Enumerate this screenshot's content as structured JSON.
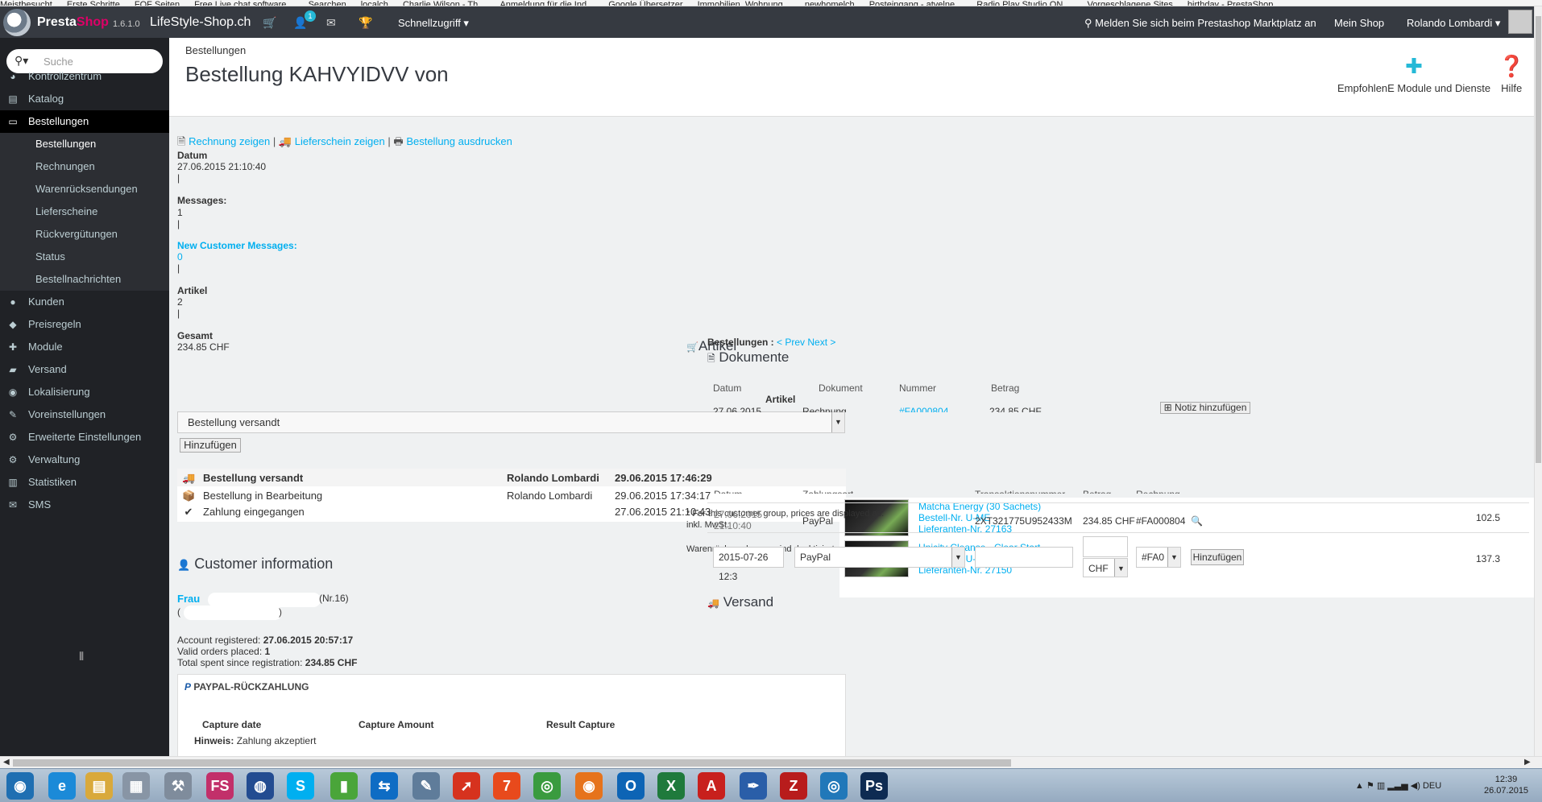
{
  "bookmarks": [
    "Meistbesucht",
    "Erste Schritte",
    "FOF Seiten",
    "Free Live chat software...",
    "Searchen",
    "localch",
    "Charlie Wilson - Th...",
    "Anmeldung für die Ind...",
    "Google Übersetzer",
    "Immobilien, Wohnung...",
    "newhomelch",
    "Posteingang - atvelne...",
    "Radio Play Studio ON ...",
    "Vorgeschlagene Sites",
    "birthday - PrestaShop ..."
  ],
  "topbar": {
    "brand_main": "Presta",
    "brand_accent": "Shop",
    "version": "1.6.1.0",
    "shop_name": "LifeStyle-Shop.ch",
    "notification_count": "1",
    "quick_access": "Schnellzugriff ▾",
    "marketplace": "Melden Sie sich beim Prestashop Marktplatz an",
    "my_shop": "Mein Shop",
    "user": "Rolando Lombardi ▾"
  },
  "sidebar": {
    "search_placeholder": "Suche",
    "items": [
      {
        "label": "Kontrollzentrum",
        "icon": "◕"
      },
      {
        "label": "Katalog",
        "icon": "▤"
      },
      {
        "label": "Bestellungen",
        "icon": "▭"
      },
      {
        "label": "Kunden",
        "icon": "●"
      },
      {
        "label": "Preisregeln",
        "icon": "◆"
      },
      {
        "label": "Module",
        "icon": "✚"
      },
      {
        "label": "Versand",
        "icon": "▰"
      },
      {
        "label": "Lokalisierung",
        "icon": "◉"
      },
      {
        "label": "Voreinstellungen",
        "icon": "✎"
      },
      {
        "label": "Erweiterte Einstellungen",
        "icon": "⚙"
      },
      {
        "label": "Verwaltung",
        "icon": "⚙"
      },
      {
        "label": "Statistiken",
        "icon": "▥"
      },
      {
        "label": "SMS",
        "icon": "✉"
      }
    ],
    "subitems": [
      "Bestellungen",
      "Rechnungen",
      "Warenrücksendungen",
      "Lieferscheine",
      "Rückvergütungen",
      "Status",
      "Bestellnachrichten"
    ]
  },
  "header": {
    "breadcrumb": "Bestellungen",
    "title": "Bestellung KAHVYIDVV von",
    "modules_label": "EmpfohlenE Module und Dienste",
    "help_label": "Hilfe"
  },
  "order": {
    "links": {
      "invoice": "Rechnung zeigen",
      "delivery": "Lieferschein zeigen",
      "print": "Bestellung ausdrucken",
      "sep": "|"
    },
    "date_label": "Datum",
    "date_value": "27.06.2015 21:10:40",
    "messages_label": "Messages:",
    "messages_value": "1",
    "new_msgs_label": "New Customer Messages:",
    "new_msgs_value": "0",
    "products_label": "Artikel",
    "products_value": "2",
    "total_label": "Gesamt",
    "total_value": "234.85 CHF",
    "pipe": "|",
    "status_selected": "Bestellung versandt",
    "add_button": "Hinzufügen"
  },
  "history": [
    {
      "status": "Bestellung versandt",
      "user": "Rolando Lombardi",
      "date": "29.06.2015 17:46:29",
      "icon": "🚚",
      "bold": true
    },
    {
      "status": "Bestellung in Bearbeitung",
      "user": "Rolando Lombardi",
      "date": "29.06.2015 17:34:17",
      "icon": "📦",
      "bold": false
    },
    {
      "status": "Zahlung eingegangen",
      "user": "",
      "date": "27.06.2015 21:10:43",
      "icon": "✔",
      "bold": false
    }
  ],
  "customer": {
    "heading": "Customer information",
    "name": "Frau",
    "number": "(Nr.16)",
    "open_paren": "(",
    "close_paren": ")",
    "registered_label": "Account registered:",
    "registered_value": "27.06.2015 20:57:17",
    "orders_label": "Valid orders placed:",
    "orders_value": "1",
    "spent_label": "Total spent since registration:",
    "spent_value": "234.85 CHF"
  },
  "paypal": {
    "heading": "PAYPAL-RÜCKZAHLUNG",
    "col1": "Capture date",
    "col2": "Capture Amount",
    "col3": "Result Capture",
    "note_label": "Hinweis:",
    "note_value": "Zahlung akzeptiert"
  },
  "right": {
    "artikel_heading": "Artikel",
    "orders_nav_label": "Bestellungen :",
    "prev": "< Prev",
    "next": "Next >",
    "documents_heading": "Dokumente",
    "doc_cols": [
      "Datum",
      "Dokument",
      "Nummer",
      "Betrag"
    ],
    "doc_row": {
      "date": "27.06.2015",
      "type": "Rechnung",
      "number": "#FA000804",
      "amount": "234.85 CHF",
      "note": "Notiz hinzufügen"
    },
    "artikel_sub": "Artikel",
    "products": [
      {
        "name": "Matcha Energy (30 Sachets)",
        "ref": "Bestell-Nr. U-ME",
        "supplier": "Lieferanten-Nr. 27163",
        "price": "102.5"
      },
      {
        "name": "Unicity Cleanse - Clear Start",
        "ref": "Bestell-Nr. U-CS",
        "supplier": "Lieferanten-Nr. 27150",
        "price": "137.3"
      }
    ],
    "pay_cols": [
      "Datum",
      "Zahlungsart",
      "Transaktionsnummer",
      "Betrag",
      "Rechnung"
    ],
    "price_note": "* For this customer group, prices are displayed as:",
    "price_note2": "inkl. MwSt.",
    "pay_row": {
      "date": "27.06.2015",
      "time": "21:10:40",
      "method": "PayPal",
      "txn": "2XT321775U952433M",
      "amount": "234.85 CHF",
      "invoice": "#FA000804"
    },
    "returns_note": "Warenrücksendungen sind deaktiviert",
    "new_pay": {
      "date": "2015-07-26 12:3",
      "method": "PayPal",
      "currency": "CHF",
      "invoice": "#FA0",
      "button": "Hinzufügen"
    },
    "shipping_heading": "Versand"
  },
  "taskbar": {
    "lang": "DEU",
    "time": "12:39",
    "date": "26.07.2015",
    "apps": [
      {
        "name": "start",
        "color": "#1f6fb2",
        "glyph": "◉"
      },
      {
        "name": "internet-explorer",
        "color": "#1b8ad8",
        "glyph": "e"
      },
      {
        "name": "file-explorer",
        "color": "#d9a93b",
        "glyph": "▤"
      },
      {
        "name": "calculator",
        "color": "#8895a5",
        "glyph": "▦"
      },
      {
        "name": "tool",
        "color": "#7f8c9c",
        "glyph": "⚒"
      },
      {
        "name": "fs-app",
        "color": "#c2306a",
        "glyph": "FS"
      },
      {
        "name": "circle-app",
        "color": "#234c91",
        "glyph": "◍"
      },
      {
        "name": "skype",
        "color": "#00aff0",
        "glyph": "S"
      },
      {
        "name": "shopping-bag",
        "color": "#4aa53a",
        "glyph": "▮"
      },
      {
        "name": "teamviewer",
        "color": "#0e6cc4",
        "glyph": "⇆"
      },
      {
        "name": "notepad",
        "color": "#5f7c9a",
        "glyph": "✎"
      },
      {
        "name": "arrow-app",
        "color": "#d6321e",
        "glyph": "➚"
      },
      {
        "name": "seven-app",
        "color": "#e84a1c",
        "glyph": "7"
      },
      {
        "name": "chrome",
        "color": "#3a9b3f",
        "glyph": "◎"
      },
      {
        "name": "firefox",
        "color": "#e6731c",
        "glyph": "◉"
      },
      {
        "name": "outlook",
        "color": "#0d64b5",
        "glyph": "O"
      },
      {
        "name": "excel",
        "color": "#1f7a3c",
        "glyph": "X"
      },
      {
        "name": "acrobat",
        "color": "#c8201d",
        "glyph": "A"
      },
      {
        "name": "pen-app",
        "color": "#2a5ea8",
        "glyph": "✒"
      },
      {
        "name": "filezilla",
        "color": "#b81c1c",
        "glyph": "Z"
      },
      {
        "name": "dial-app",
        "color": "#2178b9",
        "glyph": "◎"
      },
      {
        "name": "photoshop",
        "color": "#0e2b52",
        "glyph": "Ps"
      }
    ]
  }
}
